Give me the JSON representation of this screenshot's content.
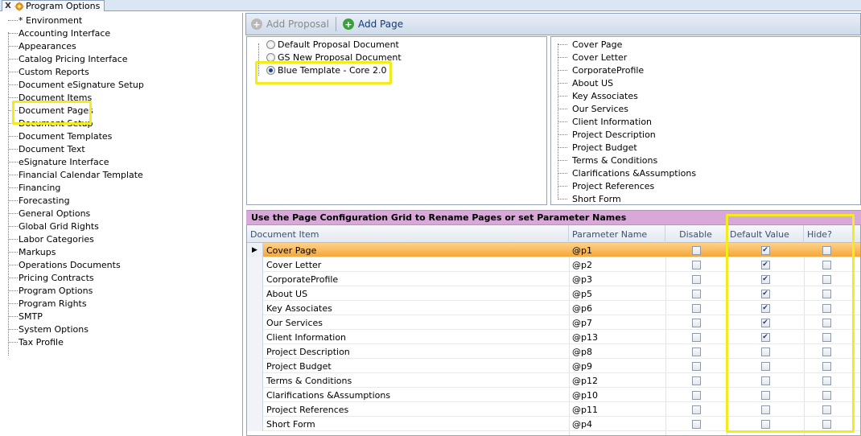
{
  "tab": {
    "close": "X",
    "title": "Program Options"
  },
  "tree": {
    "items": [
      "* Environment",
      "Accounting Interface",
      "Appearances",
      "Catalog Pricing Interface",
      "Custom Reports",
      "Document eSignature Setup",
      "Document Items",
      "Document Pages",
      "Document Setup",
      "Document Templates",
      "Document Text",
      "eSignature Interface",
      "Financial Calendar Template",
      "Financing",
      "Forecasting",
      "General Options",
      "Global Grid Rights",
      "Labor Categories",
      "Markups",
      "Operations Documents",
      "Pricing Contracts",
      "Program Options",
      "Program Rights",
      "SMTP",
      "System Options",
      "Tax Profile"
    ],
    "selected": "Document Pages"
  },
  "toolbar": {
    "add_proposal": "Add Proposal",
    "add_page": "Add Page"
  },
  "documents": [
    {
      "label": "Default Proposal Document",
      "selected": false
    },
    {
      "label": "GS New Proposal Document",
      "selected": false
    },
    {
      "label": "Blue Template - Core 2.0",
      "selected": true
    }
  ],
  "pages": [
    "Cover Page",
    "Cover Letter",
    "CorporateProfile",
    "About US",
    "Key Associates",
    "Our Services",
    "Client Information",
    "Project Description",
    "Project Budget",
    "Terms & Conditions",
    "Clarifications &Assumptions",
    "Project References",
    "Short Form"
  ],
  "grid": {
    "caption": "Use the Page Configuration Grid to Rename Pages or set Parameter Names",
    "columns": {
      "document_item": "Document Item",
      "parameter_name": "Parameter Name",
      "disable": "Disable",
      "default_value": "Default Value",
      "hide": "Hide?"
    },
    "rows": [
      {
        "item": "Cover Page",
        "param": "@p1",
        "disable": false,
        "default": true,
        "hide": false
      },
      {
        "item": "Cover Letter",
        "param": "@p2",
        "disable": false,
        "default": true,
        "hide": false
      },
      {
        "item": "CorporateProfile",
        "param": "@p3",
        "disable": false,
        "default": true,
        "hide": false
      },
      {
        "item": "About US",
        "param": "@p5",
        "disable": false,
        "default": true,
        "hide": false
      },
      {
        "item": "Key Associates",
        "param": "@p6",
        "disable": false,
        "default": true,
        "hide": false
      },
      {
        "item": "Our Services",
        "param": "@p7",
        "disable": false,
        "default": true,
        "hide": false
      },
      {
        "item": "Client Information",
        "param": "@p13",
        "disable": false,
        "default": true,
        "hide": false
      },
      {
        "item": "Project Description",
        "param": "@p8",
        "disable": false,
        "default": false,
        "hide": false
      },
      {
        "item": "Project Budget",
        "param": "@p9",
        "disable": false,
        "default": false,
        "hide": false
      },
      {
        "item": "Terms & Conditions",
        "param": "@p12",
        "disable": false,
        "default": false,
        "hide": false
      },
      {
        "item": "Clarifications &Assumptions",
        "param": "@p10",
        "disable": false,
        "default": false,
        "hide": false
      },
      {
        "item": "Project References",
        "param": "@p11",
        "disable": false,
        "default": false,
        "hide": false
      },
      {
        "item": "Short Form",
        "param": "@p4",
        "disable": false,
        "default": false,
        "hide": false
      }
    ],
    "active_row": 0
  },
  "colors": {
    "highlight": "#f2ec1c",
    "caption_bg": "#d8a8d8",
    "active_row": "#f4a838"
  }
}
